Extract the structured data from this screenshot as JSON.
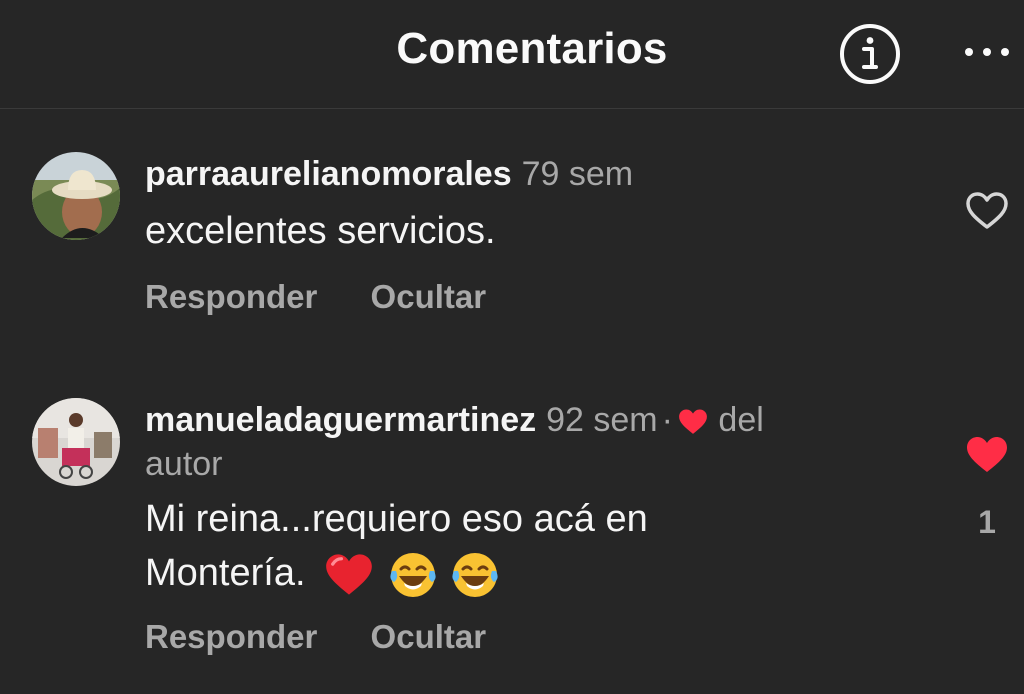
{
  "header": {
    "title": "Comentarios"
  },
  "comments": [
    {
      "username": "parraaurelianomorales",
      "time": "79 sem",
      "text": "excelentes servicios.",
      "reply_label": "Responder",
      "hide_label": "Ocultar",
      "liked": false
    },
    {
      "username": "manueladaguermartinez",
      "time": "92 sem",
      "author_like_text": "del",
      "author_like_text_2": "autor",
      "text_line1": "Mi reina...requiero eso acá en",
      "text_line2": "Montería.",
      "reply_label": "Responder",
      "hide_label": "Ocultar",
      "liked": true,
      "like_count": "1"
    }
  ],
  "colors": {
    "background": "#262626",
    "primary_text": "#f5f5f5",
    "secondary_text": "#a8a8a8",
    "like_red": "#ff2d46"
  },
  "icons": [
    "info-icon",
    "more-options-icon",
    "heart-outline-icon",
    "heart-filled-icon",
    "red-heart-emoji",
    "laughing-tears-emoji"
  ]
}
